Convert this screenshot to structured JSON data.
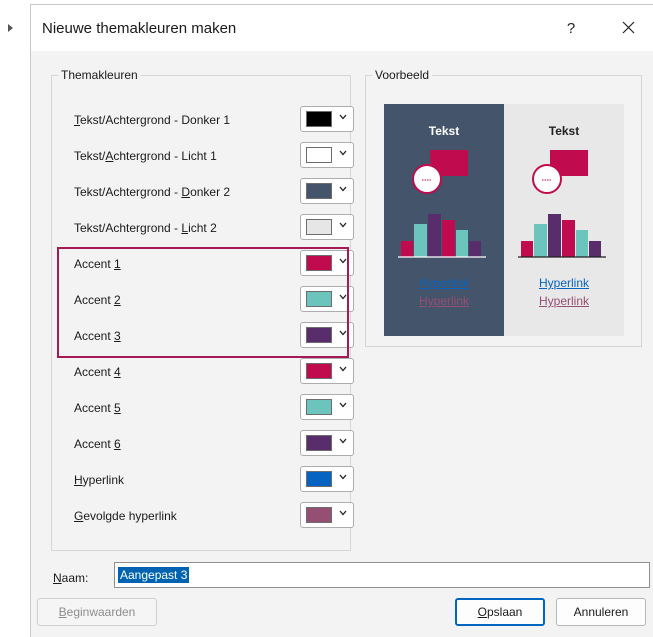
{
  "dialog": {
    "title": "Nieuwe themakleuren maken",
    "help": "?"
  },
  "theme_group": {
    "legend": "Themakleuren",
    "rows": [
      {
        "pre": "",
        "key": "T",
        "post": "ekst/Achtergrond - Donker 1",
        "color": "#000000"
      },
      {
        "pre": "Tekst/",
        "key": "A",
        "post": "chtergrond - Licht 1",
        "color": "#ffffff"
      },
      {
        "pre": "Tekst/Achtergrond - ",
        "key": "D",
        "post": "onker 2",
        "color": "#44546a"
      },
      {
        "pre": "Tekst/Achtergrond - ",
        "key": "L",
        "post": "icht 2",
        "color": "#e7e6e6"
      },
      {
        "pre": "Accent ",
        "key": "1",
        "post": "",
        "color": "#c00b4e"
      },
      {
        "pre": "Accent ",
        "key": "2",
        "post": "",
        "color": "#6cc5bd"
      },
      {
        "pre": "Accent ",
        "key": "3",
        "post": "",
        "color": "#592c6b"
      },
      {
        "pre": "Accent ",
        "key": "4",
        "post": "",
        "color": "#c00b4e"
      },
      {
        "pre": "Accent ",
        "key": "5",
        "post": "",
        "color": "#6cc5bd"
      },
      {
        "pre": "Accent ",
        "key": "6",
        "post": "",
        "color": "#592c6b"
      },
      {
        "pre": "",
        "key": "H",
        "post": "yperlink",
        "color": "#0563c1"
      },
      {
        "pre": "",
        "key": "G",
        "post": "evolgde hyperlink",
        "color": "#954f72"
      }
    ]
  },
  "preview_group": {
    "legend": "Voorbeeld",
    "dark_text": "Tekst",
    "light_text": "Tekst",
    "hyperlink": "Hyperlink",
    "followed_hyperlink": "Hyperlink",
    "colors": {
      "dark_bg": "#44546a",
      "light_bg": "#e8e8e8",
      "accent1": "#c00b4e",
      "accent2": "#6cc5bd",
      "accent3": "#592c6b",
      "hyperlink": "#0563c1",
      "followed": "#954f72"
    }
  },
  "name": {
    "pre": "",
    "key": "N",
    "post": "aam:",
    "value": "Aangepast 3"
  },
  "buttons": {
    "reset": {
      "pre": "",
      "key": "B",
      "post": "eginwaarden"
    },
    "save": {
      "pre": "",
      "key": "O",
      "post": "pslaan"
    },
    "cancel": "Annuleren"
  },
  "icons": {
    "left_arrow": "caret-right-icon",
    "close": "close-icon",
    "dropdown": "chevron-down-icon"
  }
}
